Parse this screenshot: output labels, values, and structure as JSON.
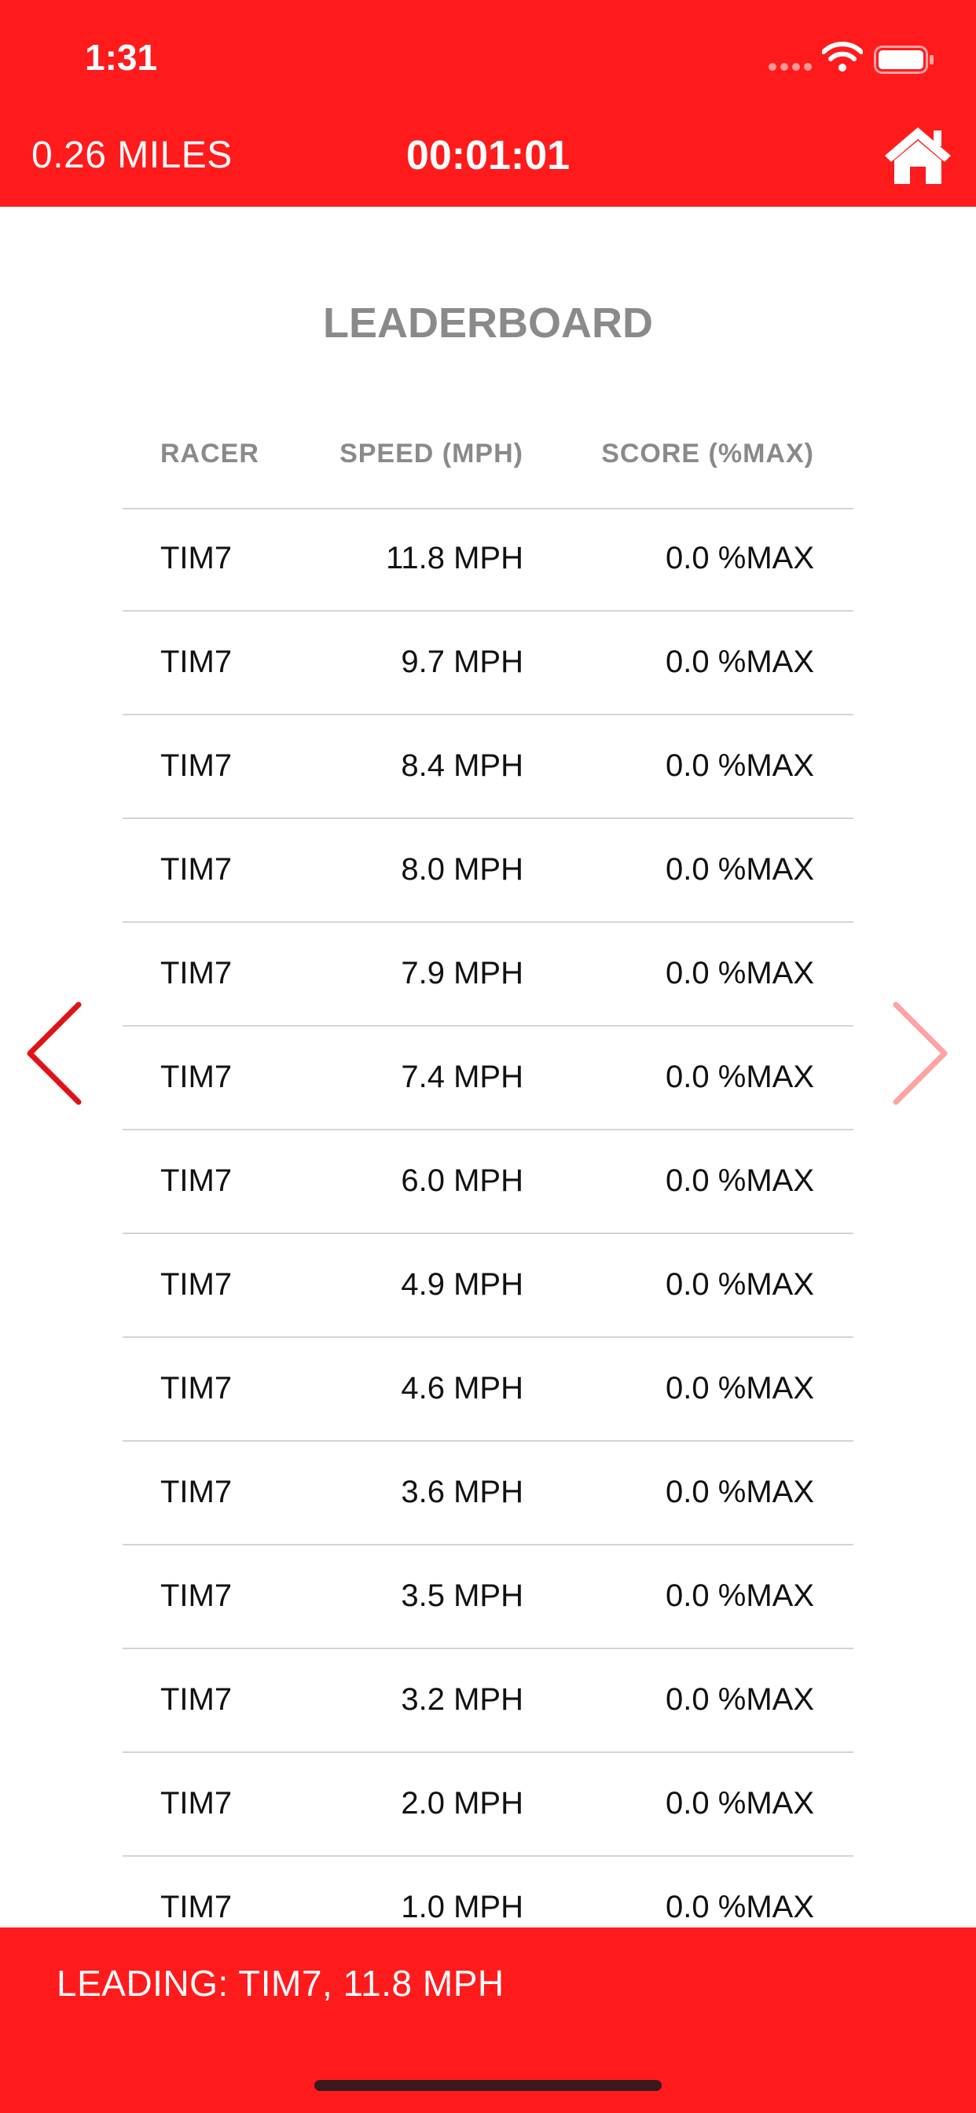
{
  "status_bar": {
    "time": "1:31"
  },
  "header": {
    "distance": "0.26 MILES",
    "timer": "00:01:01",
    "home_icon": "home-icon"
  },
  "leaderboard": {
    "title": "LEADERBOARD",
    "columns": {
      "racer": "RACER",
      "speed": "SPEED (MPH)",
      "score": "SCORE (%MAX)"
    },
    "rows": [
      {
        "racer": "TIM7",
        "speed": "11.8 MPH",
        "score": "0.0 %MAX"
      },
      {
        "racer": "TIM7",
        "speed": "9.7 MPH",
        "score": "0.0 %MAX"
      },
      {
        "racer": "TIM7",
        "speed": "8.4 MPH",
        "score": "0.0 %MAX"
      },
      {
        "racer": "TIM7",
        "speed": "8.0 MPH",
        "score": "0.0 %MAX"
      },
      {
        "racer": "TIM7",
        "speed": "7.9 MPH",
        "score": "0.0 %MAX"
      },
      {
        "racer": "TIM7",
        "speed": "7.4 MPH",
        "score": "0.0 %MAX"
      },
      {
        "racer": "TIM7",
        "speed": "6.0 MPH",
        "score": "0.0 %MAX"
      },
      {
        "racer": "TIM7",
        "speed": "4.9 MPH",
        "score": "0.0 %MAX"
      },
      {
        "racer": "TIM7",
        "speed": "4.6 MPH",
        "score": "0.0 %MAX"
      },
      {
        "racer": "TIM7",
        "speed": "3.6 MPH",
        "score": "0.0 %MAX"
      },
      {
        "racer": "TIM7",
        "speed": "3.5 MPH",
        "score": "0.0 %MAX"
      },
      {
        "racer": "TIM7",
        "speed": "3.2 MPH",
        "score": "0.0 %MAX"
      },
      {
        "racer": "TIM7",
        "speed": "2.0 MPH",
        "score": "0.0 %MAX"
      },
      {
        "racer": "TIM7",
        "speed": "1.0 MPH",
        "score": "0.0 %MAX"
      }
    ]
  },
  "footer": {
    "leading": "LEADING: TIM7, 11.8 MPH"
  },
  "colors": {
    "brand": "#ff1a1c",
    "nav_prev": "#e01418",
    "nav_next_disabled": "#ffa3a5",
    "header_text": "#8a8a8a"
  },
  "icons": {
    "prev": "chevron-left-icon",
    "next": "chevron-right-icon",
    "wifi": "wifi-icon",
    "battery": "battery-icon"
  }
}
